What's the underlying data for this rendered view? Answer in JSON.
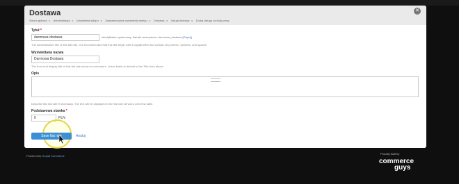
{
  "dialog": {
    "title": "Dostawa",
    "close_icon": "close-icon"
  },
  "breadcrumb": [
    "Strona główna",
    "Administracja",
    "Ustawienia sklepu",
    "Zaawansowane ustawienia sklepu",
    "Dostawa",
    "Usługi dostawy",
    "Dodaj usługę za stałą cenę"
  ],
  "form": {
    "title_label": "Tytuł",
    "title_required_mark": "*",
    "title_value": "darmowa dostawa",
    "machine_name_text": "Identyfikator systemowy: flatrate wewnętrzne: darmowa_dostawa",
    "machine_name_edit": "Edytuj",
    "title_description": "The administrative title of this flat rate. It is recommended that this title begin with a capital letter and contain only letters, numbers, and spaces.",
    "display_title_label": "Wyświetlana nazwa",
    "display_title_value": "Darmowa Dostawa",
    "display_title_description": "The front end display title of this flat rate shown to customers. Leave blank to default to the Title from above.",
    "description_label": "Opis",
    "description_value": "",
    "description_help": "Describe this flat rate if necessary. The text will be displayed in the flat rate services overview table.",
    "base_rate_label": "Podstawowa stawka",
    "base_rate_required_mark": "*",
    "base_rate_value": "0",
    "base_rate_currency": "PLN"
  },
  "actions": {
    "save_label": "Save flat rate",
    "cancel_label": "Anuluj"
  },
  "footer": {
    "powered_by_prefix": "Powered by",
    "powered_by_link": "Drupal Commerce",
    "proudly_built_by": "Proudly built by",
    "logo_line1": "commerce",
    "logo_line2": "guys"
  },
  "colors": {
    "background": "#0f0f0f",
    "panel": "#f4f4f4",
    "primary_button": "#3b8fd4",
    "link": "#3b78c2",
    "cursor_halo": "#e5d54a"
  }
}
